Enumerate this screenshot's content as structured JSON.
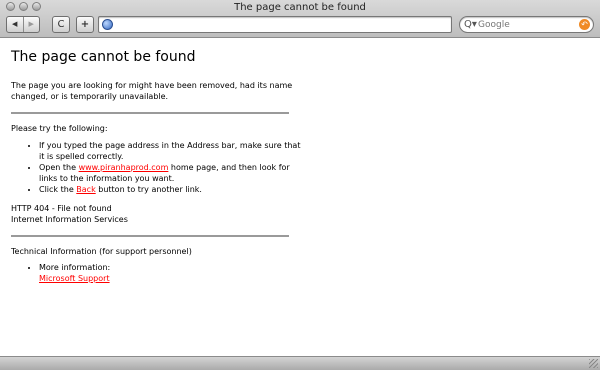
{
  "window": {
    "title": "The page cannot be found"
  },
  "toolbar": {
    "back_glyph": "◀",
    "forward_glyph": "▶",
    "reload_glyph": "C",
    "add_bookmark_glyph": "+",
    "address_value": "",
    "search_placeholder": "Google",
    "search_glyph": "Q▾",
    "snapback_glyph": "↶"
  },
  "content": {
    "heading": "The page cannot be found",
    "intro": "The page you are looking for might have been removed, had its name changed, or is temporarily unavailable.",
    "try_heading": "Please try the following:",
    "tips": {
      "tip1": "If you typed the page address in the Address bar, make sure that it is spelled correctly.",
      "tip2_prefix": "Open the ",
      "tip2_link": "www.piranhaprod.com",
      "tip2_suffix": " home page, and then look for links to the information you want.",
      "tip3_prefix": "Click the ",
      "tip3_link": "Back",
      "tip3_suffix": " button to try another link."
    },
    "http_status": "HTTP 404 - File not found",
    "server": "Internet Information Services",
    "tech_heading": "Technical Information (for support personnel)",
    "more_info_label": "More information:",
    "support_link": "Microsoft Support"
  },
  "colors": {
    "link": "#ff0000",
    "divider": "#9a9a9a"
  }
}
